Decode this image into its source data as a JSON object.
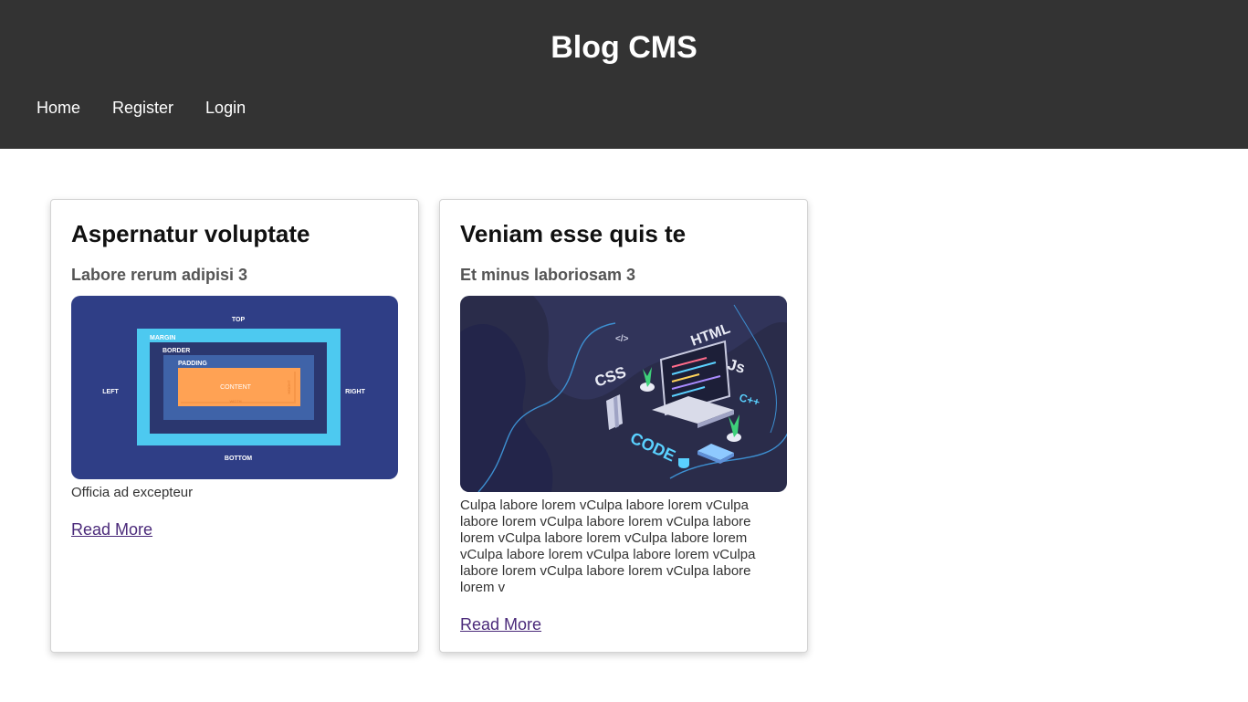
{
  "site": {
    "title": "Blog CMS"
  },
  "nav": {
    "items": [
      {
        "label": "Home"
      },
      {
        "label": "Register"
      },
      {
        "label": "Login"
      }
    ]
  },
  "posts": [
    {
      "title": "Aspernatur voluptate",
      "subtitle": "Labore rerum adipisi 3",
      "image": {
        "kind": "css-box-model-diagram",
        "labels": {
          "top": "TOP",
          "left": "LEFT",
          "right": "RIGHT",
          "bottom": "BOTTOM",
          "margin": "MARGIN",
          "border": "BORDER",
          "padding": "PADDING",
          "content": "CONTENT",
          "width": "WIDTH",
          "height": "HEIGHT"
        }
      },
      "excerpt": "Officia ad excepteur",
      "read_more": "Read More"
    },
    {
      "title": "Veniam esse quis te",
      "subtitle": "Et minus laboriosam 3",
      "image": {
        "kind": "isometric-coding-illustration",
        "labels": {
          "css": "CSS",
          "html": "HTML",
          "js": "Js",
          "cpp": "C++",
          "tag": "</>",
          "code": "CODE"
        }
      },
      "excerpt": "Culpa labore lorem vCulpa labore lorem vCulpa labore lorem vCulpa labore lorem vCulpa labore lorem vCulpa labore lorem vCulpa labore lorem vCulpa labore lorem vCulpa labore lorem vCulpa labore lorem vCulpa labore lorem vCulpa labore lorem v",
      "read_more": "Read More"
    }
  ],
  "colors": {
    "header_bg": "#333333",
    "link": "#4b2a7a",
    "diagram_bg": "#2f3e86",
    "diagram_margin": "#4dc9f0",
    "diagram_border": "#2b376f",
    "diagram_padding": "#3f63a8",
    "diagram_content": "#ffa254",
    "illustration_bg": "#2a2c4a"
  }
}
